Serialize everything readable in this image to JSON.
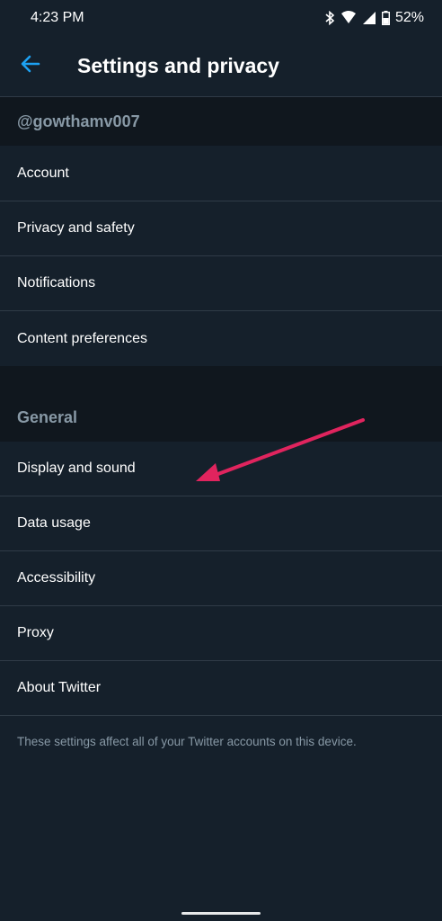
{
  "status_bar": {
    "time": "4:23 PM",
    "battery": "52%",
    "icons": [
      "bluetooth-icon",
      "wifi-icon",
      "signal-icon",
      "battery-icon"
    ]
  },
  "header": {
    "title": "Settings and privacy",
    "back_icon": "back-arrow-icon"
  },
  "account_section": {
    "username": "@gowthamv007",
    "items": [
      {
        "label": "Account"
      },
      {
        "label": "Privacy and safety"
      },
      {
        "label": "Notifications"
      },
      {
        "label": "Content preferences"
      }
    ]
  },
  "general_section": {
    "title": "General",
    "items": [
      {
        "label": "Display and sound"
      },
      {
        "label": "Data usage"
      },
      {
        "label": "Accessibility"
      },
      {
        "label": "Proxy"
      },
      {
        "label": "About Twitter"
      }
    ]
  },
  "footer": {
    "note": "These settings affect all of your Twitter accounts on this device."
  },
  "colors": {
    "background": "#15202b",
    "section_header_bg": "#10171e",
    "accent": "#1da1f2",
    "annotation_arrow": "#e0245e",
    "muted_text": "#8899a6"
  }
}
